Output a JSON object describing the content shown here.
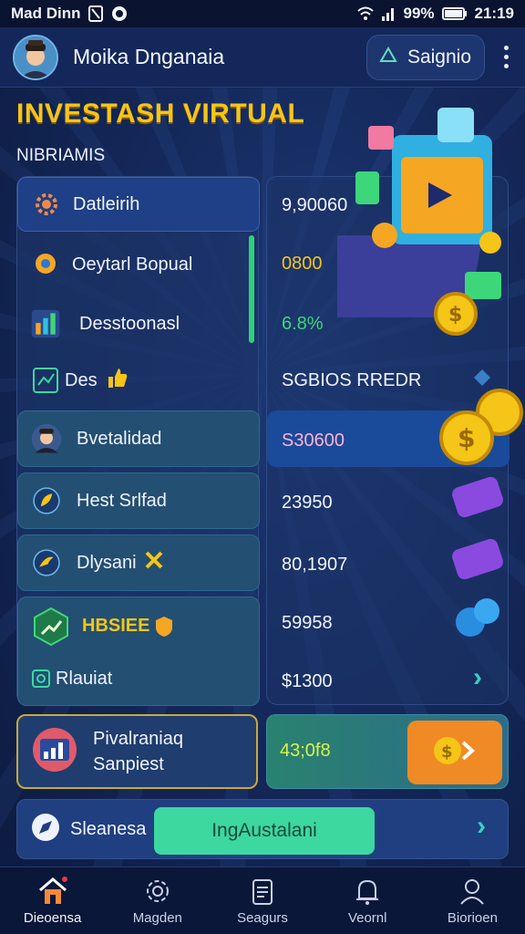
{
  "status_bar": {
    "carrier": "Mad Dinn",
    "battery": "99%",
    "time": "21:19"
  },
  "header": {
    "user_name": "Moika Dnganaia",
    "settings_label": "Saignio"
  },
  "page_title": "INVESTASH VIRTUAL",
  "section_label": "NIBRIAMIS",
  "left_rows": [
    {
      "label": "Datleirih",
      "icon": "gear-icon"
    },
    {
      "label": "Oeytarl Bopual",
      "icon": "chat-bubble-icon"
    },
    {
      "label": "Desstoonasl",
      "icon": "bar-chart-icon"
    },
    {
      "label": "Des",
      "icon": "document-icon",
      "badge_icon": "thumbs-up-icon"
    },
    {
      "label": "Bvetalidad",
      "icon": "avatar-icon"
    },
    {
      "label": "Hest Srlfad",
      "icon": "leaf-coin-icon"
    },
    {
      "label": "Dlysani",
      "icon": "bird-icon",
      "badge_icon": "tools-icon"
    },
    {
      "label": "HBSIEE",
      "icon": "chart-shield-icon",
      "badge_icon": "shield-badge-icon"
    },
    {
      "label": "Rlauiat",
      "icon": "frame-icon"
    }
  ],
  "right_values": [
    "9,90060",
    "0800",
    "6.8%",
    "SGBIOS RREDR",
    "S30600",
    "23950",
    "80,1907",
    "59958",
    "$1300"
  ],
  "promo": {
    "label_line1": "Pivalraniaq",
    "label_line2": "Sanpiest",
    "amount": "43;0f8"
  },
  "action_bar": {
    "label": "Sleanesa",
    "cta_label": "IngAustalani"
  },
  "bottom_nav": [
    {
      "label": "Dieoensa",
      "icon": "home-icon"
    },
    {
      "label": "Magden",
      "icon": "gear-outline-icon"
    },
    {
      "label": "Seagurs",
      "icon": "clipboard-icon"
    },
    {
      "label": "Veornl",
      "icon": "bell-icon"
    },
    {
      "label": "Biorioen",
      "icon": "profile-icon"
    }
  ],
  "colors": {
    "accent_gold": "#f5c518",
    "accent_green": "#3dd7a0",
    "accent_orange": "#f08a24",
    "background": "#14285a"
  }
}
